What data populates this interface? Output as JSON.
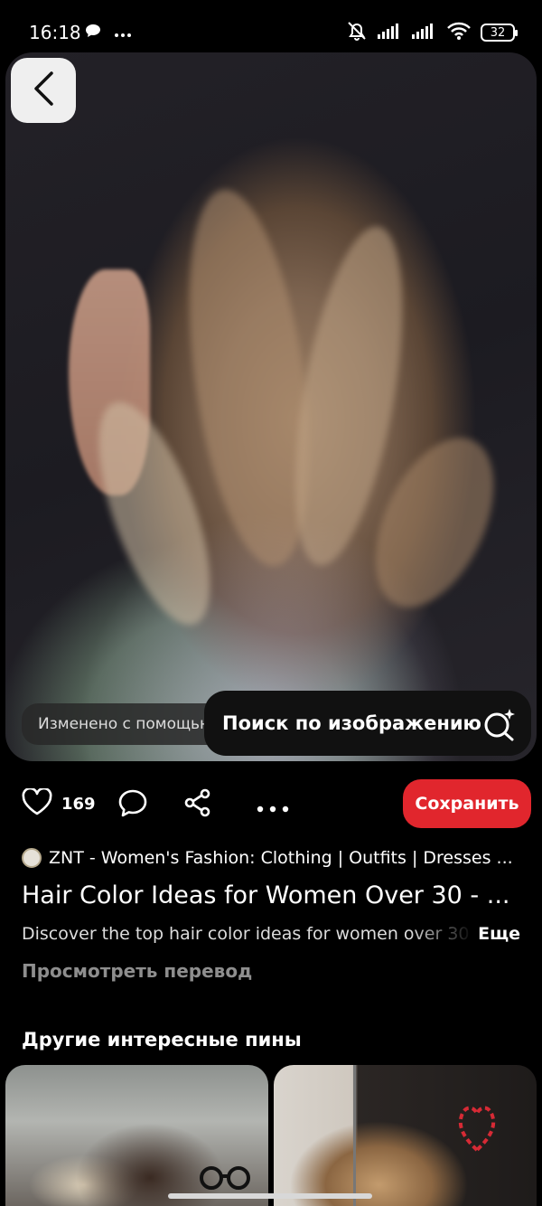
{
  "status_bar": {
    "time": "16:18",
    "battery": "32",
    "icons": [
      "chat-bubble-icon",
      "more-dots-icon",
      "mute-icon",
      "signal-icon",
      "signal-icon",
      "wifi-icon",
      "battery-icon"
    ]
  },
  "pin": {
    "edited_notice": "Изменено с помощью",
    "visual_search_label": "Поиск по изображению",
    "likes": "169",
    "save_label": "Сохранить",
    "source_name": "ZNT - Women's Fashion: Clothing | Outfits | Dresses ...",
    "title": "Hair Color Ideas for Women Over 30 - ...",
    "description": "Discover the top hair color ideas for women over 30",
    "more_label": "Еще",
    "translate_label": "Просмотреть перевод"
  },
  "related": {
    "heading": "Другие интересные пины"
  },
  "colors": {
    "background": "#000000",
    "save_button": "#e1262d",
    "back_button": "#efefef",
    "muted_text": "#8e8e8e"
  }
}
